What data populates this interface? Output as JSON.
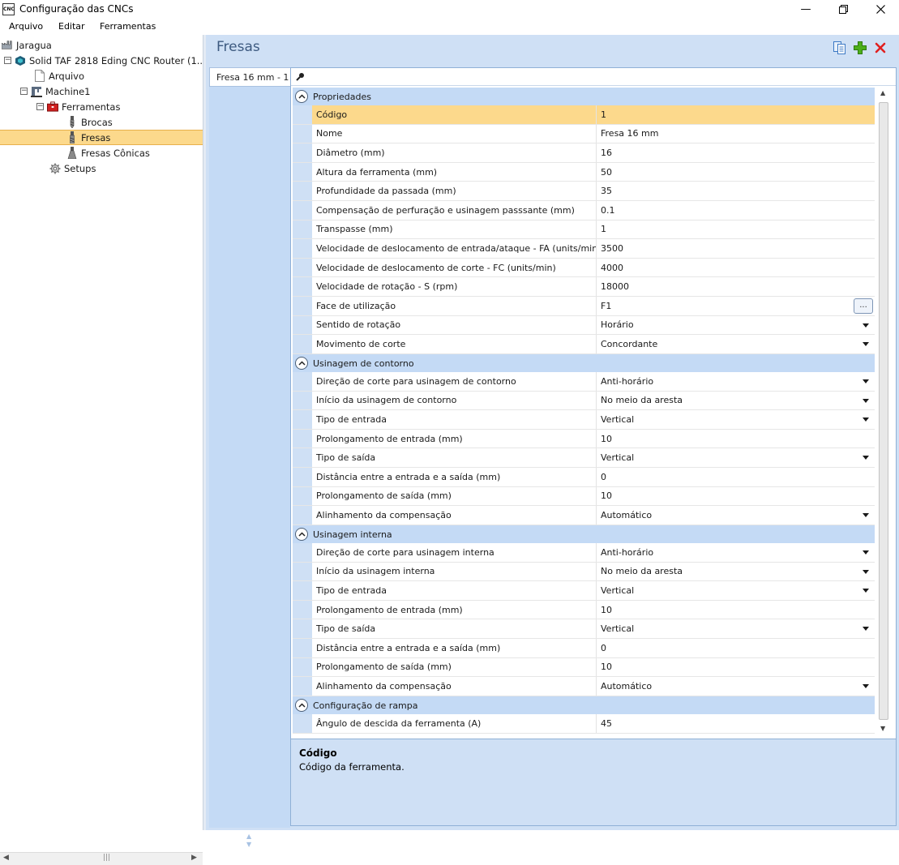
{
  "window": {
    "app_icon_text": "CNC",
    "title": "Configuração das CNCs",
    "controls": [
      "minimize",
      "maximize",
      "close"
    ]
  },
  "menu": [
    "Arquivo",
    "Editar",
    "Ferramentas"
  ],
  "tree": {
    "root": "Jaragua",
    "machine": "Solid TAF 2818 Eding CNC Router (1....",
    "arquivo": "Arquivo",
    "machine1": "Machine1",
    "ferramentas": "Ferramentas",
    "brocas": "Brocas",
    "fresas": "Fresas",
    "fresas_conicas": "Fresas Cônicas",
    "setups": "Setups",
    "selected": "Fresas"
  },
  "panel": {
    "title": "Fresas",
    "tab": "Fresa 16 mm - 1"
  },
  "categories": {
    "propriedades": "Propriedades",
    "contorno": "Usinagem de contorno",
    "interna": "Usinagem interna",
    "rampa": "Configuração de rampa"
  },
  "props": [
    {
      "name": "Código",
      "value": "1",
      "control": "none",
      "selected": true
    },
    {
      "name": "Nome",
      "value": "Fresa 16 mm",
      "control": "none"
    },
    {
      "name": "Diâmetro (mm)",
      "value": "16",
      "control": "none"
    },
    {
      "name": "Altura da ferramenta (mm)",
      "value": "50",
      "control": "none"
    },
    {
      "name": "Profundidade da passada (mm)",
      "value": "35",
      "control": "none"
    },
    {
      "name": "Compensação de perfuração e usinagem passsante (mm)",
      "value": "0.1",
      "control": "none"
    },
    {
      "name": "Transpasse (mm)",
      "value": "1",
      "control": "none"
    },
    {
      "name": "Velocidade de deslocamento de entrada/ataque - FA (units/min)",
      "value": "3500",
      "control": "none"
    },
    {
      "name": "Velocidade de deslocamento de corte - FC (units/min)",
      "value": "4000",
      "control": "none"
    },
    {
      "name": "Velocidade de rotação - S (rpm)",
      "value": "18000",
      "control": "none"
    },
    {
      "name": "Face de utilização",
      "value": "F1",
      "control": "ellipsis",
      "button_label": "..."
    },
    {
      "name": "Sentido de rotação",
      "value": "Horário",
      "control": "dropdown"
    },
    {
      "name": "Movimento de corte",
      "value": "Concordante",
      "control": "dropdown"
    }
  ],
  "contorno": [
    {
      "name": "Direção de corte para usinagem de contorno",
      "value": "Anti-horário",
      "control": "dropdown"
    },
    {
      "name": "Início da usinagem de contorno",
      "value": "No meio da aresta",
      "control": "dropdown"
    },
    {
      "name": "Tipo de entrada",
      "value": "Vertical",
      "control": "dropdown"
    },
    {
      "name": "Prolongamento de entrada (mm)",
      "value": "10",
      "control": "none"
    },
    {
      "name": "Tipo de saída",
      "value": "Vertical",
      "control": "dropdown"
    },
    {
      "name": "Distância entre a entrada e a saída (mm)",
      "value": "0",
      "control": "none"
    },
    {
      "name": "Prolongamento de saída (mm)",
      "value": "10",
      "control": "none"
    },
    {
      "name": "Alinhamento da compensação",
      "value": "Automático",
      "control": "dropdown"
    }
  ],
  "interna": [
    {
      "name": "Direção de corte para usinagem interna",
      "value": "Anti-horário",
      "control": "dropdown"
    },
    {
      "name": "Início da usinagem interna",
      "value": "No meio da aresta",
      "control": "dropdown"
    },
    {
      "name": "Tipo de entrada",
      "value": "Vertical",
      "control": "dropdown"
    },
    {
      "name": "Prolongamento de entrada (mm)",
      "value": "10",
      "control": "none"
    },
    {
      "name": "Tipo de saída",
      "value": "Vertical",
      "control": "dropdown"
    },
    {
      "name": "Distância entre a entrada e a saída (mm)",
      "value": "0",
      "control": "none"
    },
    {
      "name": "Prolongamento de saída (mm)",
      "value": "10",
      "control": "none"
    },
    {
      "name": "Alinhamento da compensação",
      "value": "Automático",
      "control": "dropdown"
    }
  ],
  "rampa": [
    {
      "name": "Ângulo de descida da ferramenta (A)",
      "value": "45",
      "control": "none"
    }
  ],
  "description": {
    "title": "Código",
    "text": "Código da ferramenta."
  },
  "colors": {
    "selection": "#fcd98c",
    "panel_bg": "#cfe0f5",
    "category_bg": "#c4daf5",
    "title_text": "#3d5a80",
    "add_icon": "#4caf1a",
    "delete_icon": "#e02020"
  },
  "icons": [
    "factory-icon",
    "cube-icon",
    "document-icon",
    "machine-icon",
    "toolbox-icon",
    "drill-bit-icon",
    "end-mill-icon",
    "conical-mill-icon",
    "gear-icon",
    "copy-icon",
    "add-icon",
    "delete-icon",
    "search-icon",
    "chevron-up-icon",
    "dropdown-arrow-icon"
  ]
}
